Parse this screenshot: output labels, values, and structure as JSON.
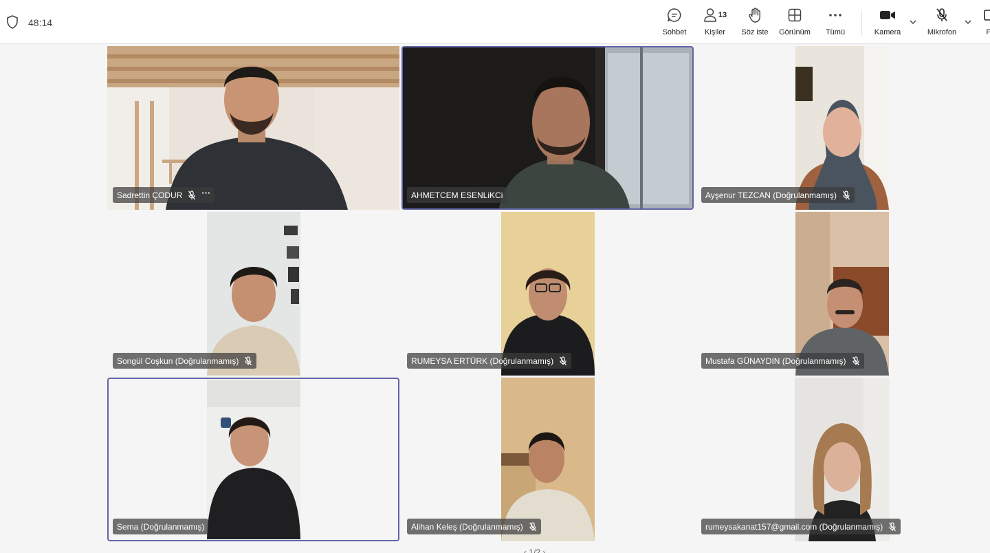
{
  "meeting": {
    "timer": "48:14"
  },
  "toolbar": {
    "chat_label": "Sohbet",
    "people_label": "Kişiler",
    "people_count": "13",
    "raise_hand_label": "Söz iste",
    "view_label": "Görünüm",
    "more_label": "Tümü",
    "camera_label": "Kamera",
    "mic_label": "Mikrofon",
    "share_label": "P"
  },
  "participants": [
    {
      "name": "Sadrettin ÇODUR",
      "muted": true,
      "more": "···"
    },
    {
      "name": "AHMETCEM ESENLiKCi",
      "muted": false,
      "speaking": true
    },
    {
      "name": "Ayşenur TEZCAN (Doğrulanmamış)",
      "muted": true
    },
    {
      "name": "Songül Coşkun (Doğrulanmamış)",
      "muted": true
    },
    {
      "name": "RUMEYSA ERTÜRK (Doğrulanmamış)",
      "muted": true
    },
    {
      "name": "Mustafa GÜNAYDIN (Doğrulanmamış)",
      "muted": true
    },
    {
      "name": "Sema (Doğrulanmamış)",
      "muted": false,
      "speaking": true
    },
    {
      "name": "Alihan Keleş (Doğrulanmamış)",
      "muted": true
    },
    {
      "name": "rumeysakanat157@gmail.com (Doğrulanmamış)",
      "muted": true
    }
  ],
  "pager": {
    "text": "‹  1/2  ›"
  },
  "colors": {
    "accent": "#6264a7",
    "tag_bg": "#3c3c3c",
    "background": "#f5f5f5"
  }
}
